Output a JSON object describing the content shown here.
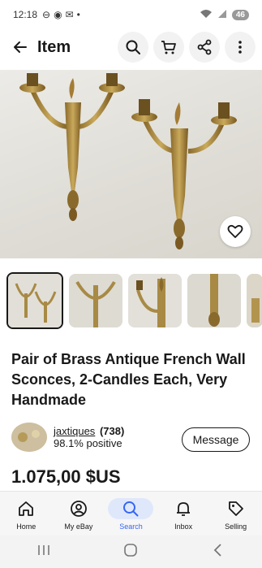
{
  "status": {
    "time": "12:18",
    "battery": "46"
  },
  "header": {
    "title": "Item"
  },
  "listing": {
    "title": "Pair of Brass Antique French Wall Sconces, 2-Candles Each, Very Handmade",
    "price": "1.075,00 $US"
  },
  "seller": {
    "name": "jaxtiques",
    "score": "(738)",
    "positive": "98.1% positive"
  },
  "actions": {
    "message_label": "Message"
  },
  "tabs": [
    {
      "label": "Home",
      "icon": "home-icon"
    },
    {
      "label": "My eBay",
      "icon": "user-icon"
    },
    {
      "label": "Search",
      "icon": "search-icon",
      "active": true
    },
    {
      "label": "Inbox",
      "icon": "bell-icon"
    },
    {
      "label": "Selling",
      "icon": "tag-icon"
    }
  ],
  "colors": {
    "accent": "#3665f3",
    "active_tab_bg": "#dfe8fb"
  }
}
